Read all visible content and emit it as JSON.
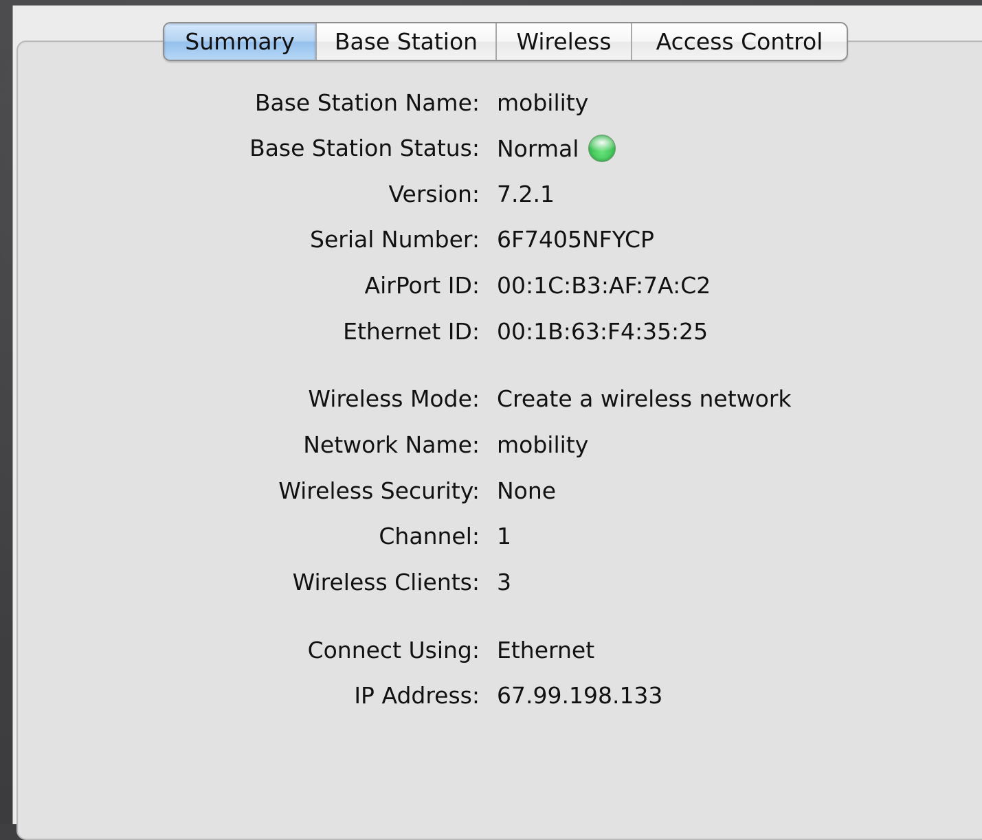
{
  "tabs": {
    "summary": "Summary",
    "base_station": "Base Station",
    "wireless": "Wireless",
    "access_control": "Access Control",
    "selected": "Summary"
  },
  "summary": {
    "base_station_name": {
      "label": "Base Station Name:",
      "value": "mobility"
    },
    "base_station_status": {
      "label": "Base Station Status:",
      "value": "Normal",
      "indicator_color": "#3fc256"
    },
    "version": {
      "label": "Version:",
      "value": "7.2.1"
    },
    "serial_number": {
      "label": "Serial Number:",
      "value": "6F7405NFYCP"
    },
    "airport_id": {
      "label": "AirPort ID:",
      "value": "00:1C:B3:AF:7A:C2"
    },
    "ethernet_id": {
      "label": "Ethernet ID:",
      "value": "00:1B:63:F4:35:25"
    },
    "wireless_mode": {
      "label": "Wireless Mode:",
      "value": "Create a wireless network"
    },
    "network_name": {
      "label": "Network Name:",
      "value": "mobility"
    },
    "wireless_security": {
      "label": "Wireless Security:",
      "value": "None"
    },
    "channel": {
      "label": "Channel:",
      "value": "1"
    },
    "wireless_clients": {
      "label": "Wireless Clients:",
      "value": "3"
    },
    "connect_using": {
      "label": "Connect Using:",
      "value": "Ethernet"
    },
    "ip_address": {
      "label": "IP Address:",
      "value": "67.99.198.133"
    }
  },
  "colors": {
    "selected_tab": "#b4d3f3",
    "panel_background": "#e2e2e2",
    "window_background": "#3f3f41"
  }
}
